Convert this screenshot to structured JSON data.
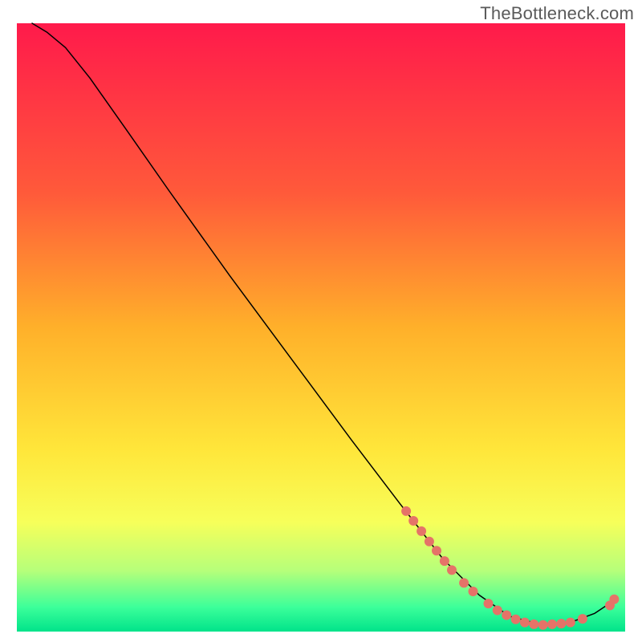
{
  "watermark": "TheBottleneck.com",
  "chart_data": {
    "type": "line",
    "title": "",
    "xlabel": "",
    "ylabel": "",
    "xlim": [
      0,
      100
    ],
    "ylim": [
      0,
      100
    ],
    "background_gradient_stops": [
      {
        "offset": 0.0,
        "color": "#ff1a4b"
      },
      {
        "offset": 0.28,
        "color": "#ff5a3a"
      },
      {
        "offset": 0.5,
        "color": "#ffb02a"
      },
      {
        "offset": 0.7,
        "color": "#ffe63a"
      },
      {
        "offset": 0.82,
        "color": "#f7ff5a"
      },
      {
        "offset": 0.9,
        "color": "#b6ff7a"
      },
      {
        "offset": 0.96,
        "color": "#3cff9a"
      },
      {
        "offset": 1.0,
        "color": "#00e38a"
      }
    ],
    "series": [
      {
        "name": "curve",
        "type": "line",
        "stroke": "#000000",
        "stroke_width": 1.5,
        "points": [
          {
            "x": 2.5,
            "y": 100.0
          },
          {
            "x": 5.0,
            "y": 98.5
          },
          {
            "x": 8.0,
            "y": 96.0
          },
          {
            "x": 12.0,
            "y": 91.0
          },
          {
            "x": 18.0,
            "y": 82.5
          },
          {
            "x": 25.0,
            "y": 72.5
          },
          {
            "x": 35.0,
            "y": 58.5
          },
          {
            "x": 45.0,
            "y": 45.0
          },
          {
            "x": 55.0,
            "y": 31.5
          },
          {
            "x": 63.0,
            "y": 21.0
          },
          {
            "x": 70.0,
            "y": 12.0
          },
          {
            "x": 76.0,
            "y": 6.0
          },
          {
            "x": 81.0,
            "y": 2.5
          },
          {
            "x": 86.0,
            "y": 1.2
          },
          {
            "x": 91.0,
            "y": 1.5
          },
          {
            "x": 95.0,
            "y": 3.0
          },
          {
            "x": 98.0,
            "y": 5.0
          }
        ]
      },
      {
        "name": "markers",
        "type": "scatter",
        "color": "#e57368",
        "radius": 6,
        "points": [
          {
            "x": 64.0,
            "y": 19.8
          },
          {
            "x": 65.2,
            "y": 18.2
          },
          {
            "x": 66.5,
            "y": 16.5
          },
          {
            "x": 67.8,
            "y": 14.8
          },
          {
            "x": 69.0,
            "y": 13.3
          },
          {
            "x": 70.3,
            "y": 11.6
          },
          {
            "x": 71.5,
            "y": 10.1
          },
          {
            "x": 73.5,
            "y": 8.0
          },
          {
            "x": 75.0,
            "y": 6.6
          },
          {
            "x": 77.5,
            "y": 4.6
          },
          {
            "x": 79.0,
            "y": 3.5
          },
          {
            "x": 80.5,
            "y": 2.7
          },
          {
            "x": 82.0,
            "y": 2.0
          },
          {
            "x": 83.5,
            "y": 1.5
          },
          {
            "x": 85.0,
            "y": 1.2
          },
          {
            "x": 86.5,
            "y": 1.1
          },
          {
            "x": 88.0,
            "y": 1.2
          },
          {
            "x": 89.5,
            "y": 1.3
          },
          {
            "x": 91.0,
            "y": 1.5
          },
          {
            "x": 93.0,
            "y": 2.1
          },
          {
            "x": 97.5,
            "y": 4.3
          },
          {
            "x": 98.2,
            "y": 5.3
          }
        ]
      }
    ]
  }
}
